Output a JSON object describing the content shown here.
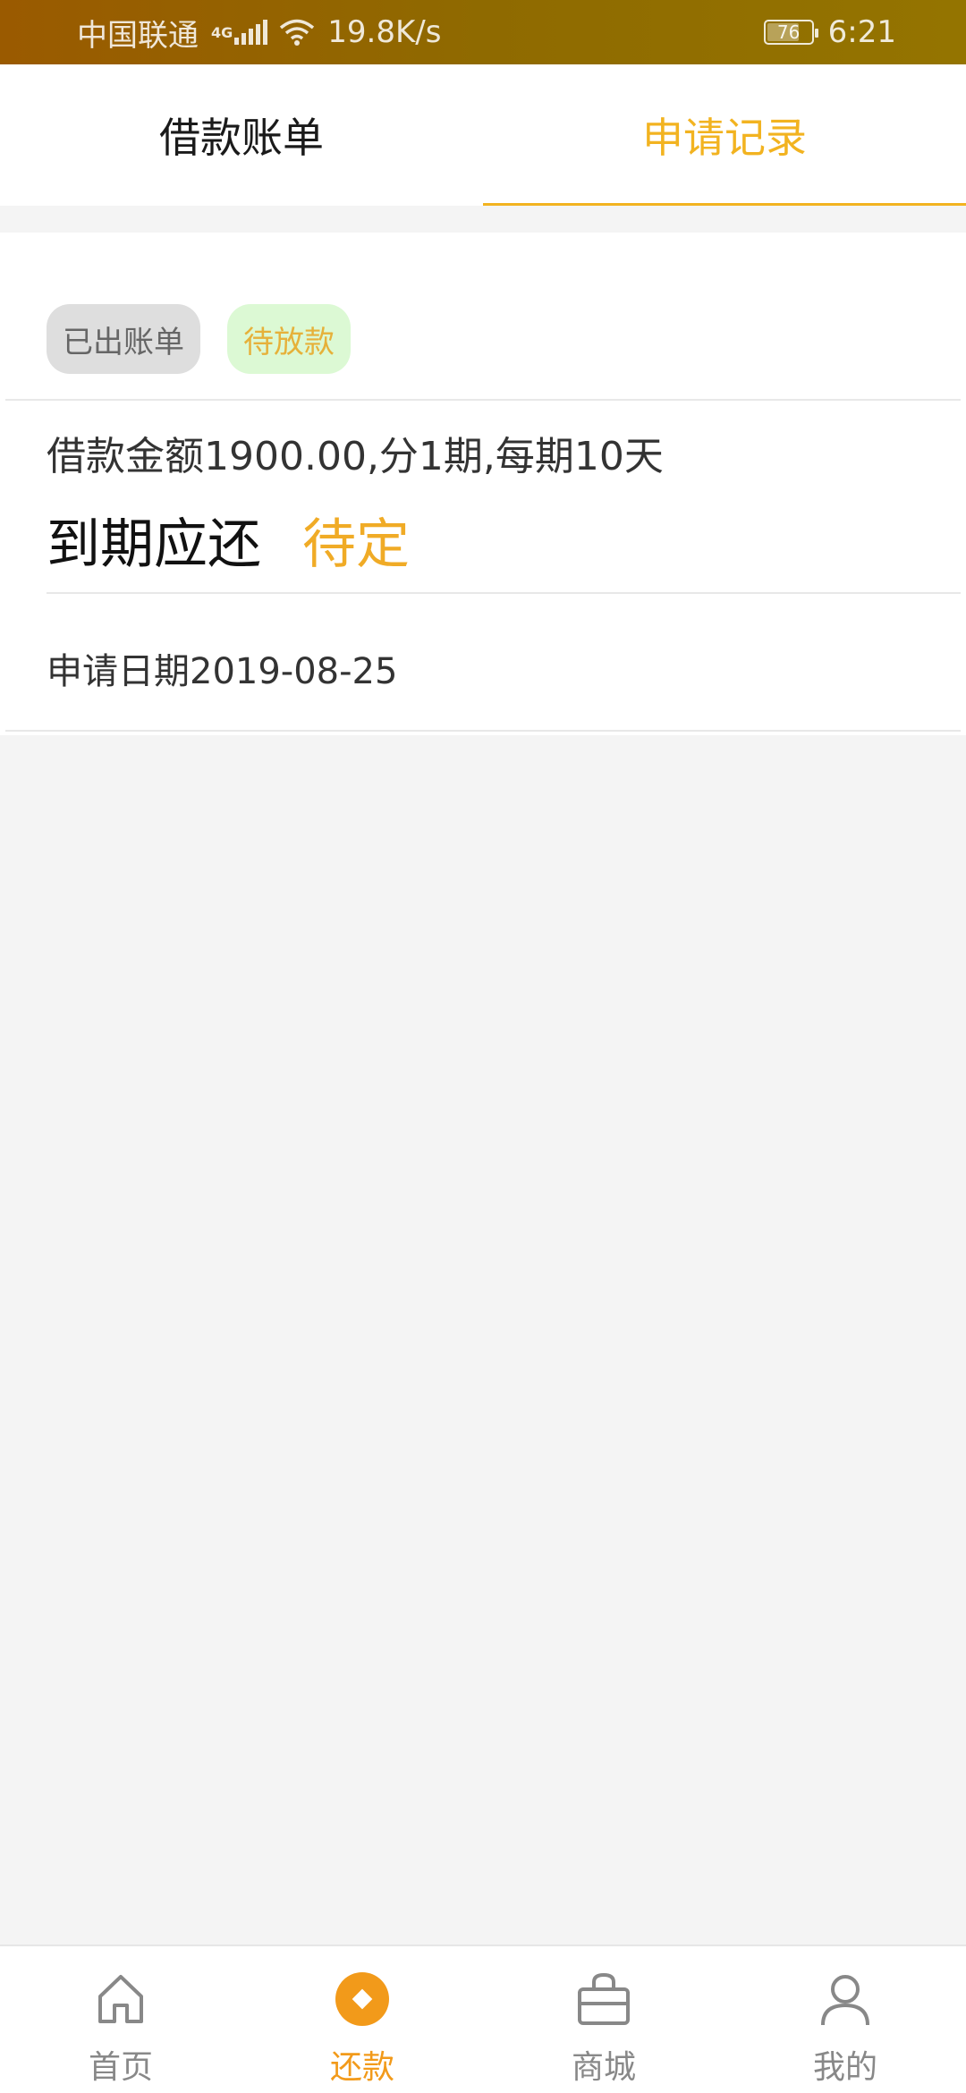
{
  "status_bar": {
    "carrier": "中国联通",
    "network_type": "4G",
    "speed": "19.8K/s",
    "battery": "76",
    "battery_level_percent": 76,
    "time": "6:21"
  },
  "tabs": [
    {
      "label": "借款账单",
      "active": false
    },
    {
      "label": "申请记录",
      "active": true
    }
  ],
  "record": {
    "chips": [
      {
        "label": "已出账单",
        "style": "gray"
      },
      {
        "label": "待放款",
        "style": "green"
      }
    ],
    "loan_desc": "借款金额1900.00,分1期,每期10天",
    "due_label": "到期应还",
    "due_value": "待定",
    "apply_date": "申请日期2019-08-25"
  },
  "bottom_nav": [
    {
      "label": "首页",
      "icon": "home-icon",
      "active": false
    },
    {
      "label": "还款",
      "icon": "repay-icon",
      "active": true
    },
    {
      "label": "商城",
      "icon": "shop-bag-icon",
      "active": false
    },
    {
      "label": "我的",
      "icon": "user-icon",
      "active": false
    }
  ],
  "colors": {
    "accent_yellow": "#f2b320",
    "accent_orange": "#f29a1a",
    "status_bar": "#9a5a00"
  }
}
